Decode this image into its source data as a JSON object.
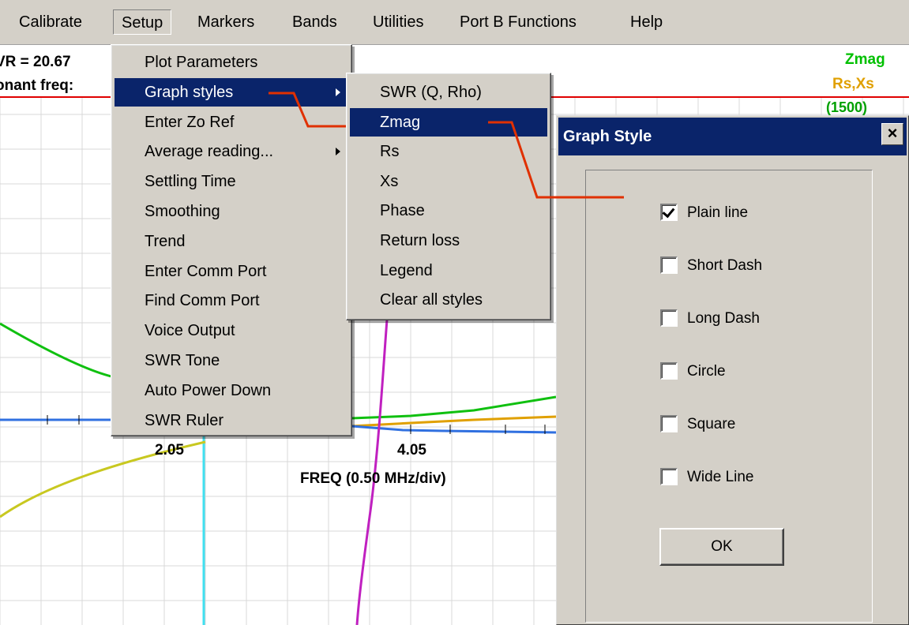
{
  "menubar": {
    "items": [
      "Calibrate",
      "Setup",
      "Markers",
      "Bands",
      "Utilities",
      "Port B Functions",
      "Help"
    ]
  },
  "readout": {
    "swr": "VR =  20.67",
    "resonant": "onant freq:"
  },
  "legend": {
    "zmag": "Zmag",
    "rsxs": "Rs,Xs",
    "tag": "(1500)"
  },
  "colors": {
    "zmag": "#00c000",
    "rsxs": "#e0a000",
    "swr_line": "#e00000",
    "green_curve": "#10c010",
    "olive_curve": "#c8c820",
    "blue_curve": "#3070e0",
    "magenta_curve": "#c020c0",
    "cyan_line": "#40e0f0",
    "highlight": "#0a246a",
    "annotation": "#e03000"
  },
  "axis": {
    "tick1": "2.05",
    "tick2": "4.05",
    "xlabel": "FREQ (0.50 MHz/div)"
  },
  "setup_menu": {
    "items": [
      {
        "label": "Plot Parameters"
      },
      {
        "label": "Graph styles",
        "submenu": true,
        "highlight": true
      },
      {
        "label": "Enter Zo Ref"
      },
      {
        "label": "Average reading...",
        "submenu": true
      },
      {
        "label": "Settling Time"
      },
      {
        "label": "Smoothing"
      },
      {
        "label": "Trend"
      },
      {
        "label": "Enter Comm Port"
      },
      {
        "label": "Find Comm Port"
      },
      {
        "label": "Voice Output"
      },
      {
        "label": "SWR Tone"
      },
      {
        "label": "Auto Power Down"
      },
      {
        "label": "SWR Ruler"
      }
    ]
  },
  "graph_styles_menu": {
    "items": [
      {
        "label": "SWR (Q, Rho)"
      },
      {
        "label": "Zmag",
        "highlight": true
      },
      {
        "label": "Rs"
      },
      {
        "label": "Xs"
      },
      {
        "label": "Phase"
      },
      {
        "label": "Return loss"
      },
      {
        "label": "Legend"
      },
      {
        "label": "Clear all styles"
      }
    ]
  },
  "dialog": {
    "title": "Graph Style",
    "close": "×",
    "options": [
      {
        "label": "Plain line",
        "checked": true
      },
      {
        "label": "Short Dash",
        "checked": false
      },
      {
        "label": "Long Dash",
        "checked": false
      },
      {
        "label": "Circle",
        "checked": false
      },
      {
        "label": "Square",
        "checked": false
      },
      {
        "label": "Wide Line",
        "checked": false
      }
    ],
    "ok": "OK"
  }
}
